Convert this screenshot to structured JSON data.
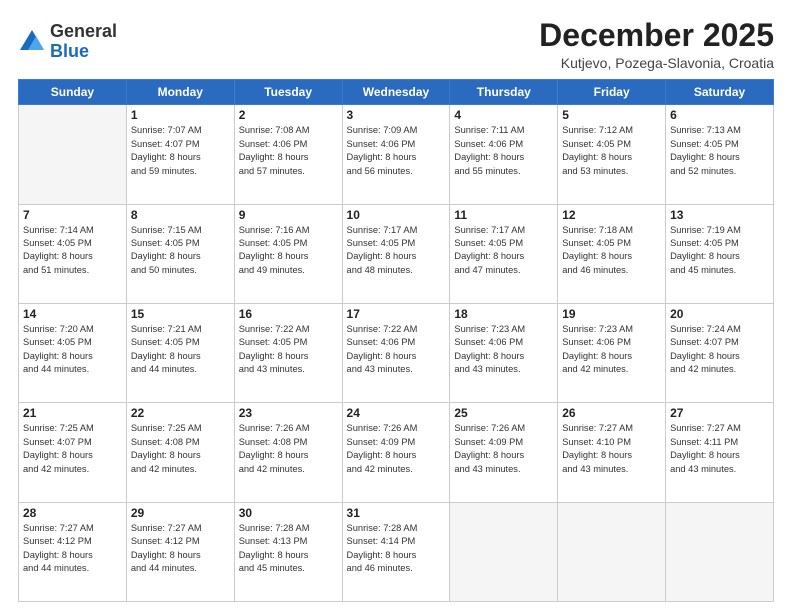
{
  "logo": {
    "general": "General",
    "blue": "Blue"
  },
  "title": "December 2025",
  "location": "Kutjevo, Pozega-Slavonia, Croatia",
  "weekdays": [
    "Sunday",
    "Monday",
    "Tuesday",
    "Wednesday",
    "Thursday",
    "Friday",
    "Saturday"
  ],
  "weeks": [
    [
      {
        "day": "",
        "info": ""
      },
      {
        "day": "1",
        "info": "Sunrise: 7:07 AM\nSunset: 4:07 PM\nDaylight: 8 hours\nand 59 minutes."
      },
      {
        "day": "2",
        "info": "Sunrise: 7:08 AM\nSunset: 4:06 PM\nDaylight: 8 hours\nand 57 minutes."
      },
      {
        "day": "3",
        "info": "Sunrise: 7:09 AM\nSunset: 4:06 PM\nDaylight: 8 hours\nand 56 minutes."
      },
      {
        "day": "4",
        "info": "Sunrise: 7:11 AM\nSunset: 4:06 PM\nDaylight: 8 hours\nand 55 minutes."
      },
      {
        "day": "5",
        "info": "Sunrise: 7:12 AM\nSunset: 4:05 PM\nDaylight: 8 hours\nand 53 minutes."
      },
      {
        "day": "6",
        "info": "Sunrise: 7:13 AM\nSunset: 4:05 PM\nDaylight: 8 hours\nand 52 minutes."
      }
    ],
    [
      {
        "day": "7",
        "info": "Sunrise: 7:14 AM\nSunset: 4:05 PM\nDaylight: 8 hours\nand 51 minutes."
      },
      {
        "day": "8",
        "info": "Sunrise: 7:15 AM\nSunset: 4:05 PM\nDaylight: 8 hours\nand 50 minutes."
      },
      {
        "day": "9",
        "info": "Sunrise: 7:16 AM\nSunset: 4:05 PM\nDaylight: 8 hours\nand 49 minutes."
      },
      {
        "day": "10",
        "info": "Sunrise: 7:17 AM\nSunset: 4:05 PM\nDaylight: 8 hours\nand 48 minutes."
      },
      {
        "day": "11",
        "info": "Sunrise: 7:17 AM\nSunset: 4:05 PM\nDaylight: 8 hours\nand 47 minutes."
      },
      {
        "day": "12",
        "info": "Sunrise: 7:18 AM\nSunset: 4:05 PM\nDaylight: 8 hours\nand 46 minutes."
      },
      {
        "day": "13",
        "info": "Sunrise: 7:19 AM\nSunset: 4:05 PM\nDaylight: 8 hours\nand 45 minutes."
      }
    ],
    [
      {
        "day": "14",
        "info": "Sunrise: 7:20 AM\nSunset: 4:05 PM\nDaylight: 8 hours\nand 44 minutes."
      },
      {
        "day": "15",
        "info": "Sunrise: 7:21 AM\nSunset: 4:05 PM\nDaylight: 8 hours\nand 44 minutes."
      },
      {
        "day": "16",
        "info": "Sunrise: 7:22 AM\nSunset: 4:05 PM\nDaylight: 8 hours\nand 43 minutes."
      },
      {
        "day": "17",
        "info": "Sunrise: 7:22 AM\nSunset: 4:06 PM\nDaylight: 8 hours\nand 43 minutes."
      },
      {
        "day": "18",
        "info": "Sunrise: 7:23 AM\nSunset: 4:06 PM\nDaylight: 8 hours\nand 43 minutes."
      },
      {
        "day": "19",
        "info": "Sunrise: 7:23 AM\nSunset: 4:06 PM\nDaylight: 8 hours\nand 42 minutes."
      },
      {
        "day": "20",
        "info": "Sunrise: 7:24 AM\nSunset: 4:07 PM\nDaylight: 8 hours\nand 42 minutes."
      }
    ],
    [
      {
        "day": "21",
        "info": "Sunrise: 7:25 AM\nSunset: 4:07 PM\nDaylight: 8 hours\nand 42 minutes."
      },
      {
        "day": "22",
        "info": "Sunrise: 7:25 AM\nSunset: 4:08 PM\nDaylight: 8 hours\nand 42 minutes."
      },
      {
        "day": "23",
        "info": "Sunrise: 7:26 AM\nSunset: 4:08 PM\nDaylight: 8 hours\nand 42 minutes."
      },
      {
        "day": "24",
        "info": "Sunrise: 7:26 AM\nSunset: 4:09 PM\nDaylight: 8 hours\nand 42 minutes."
      },
      {
        "day": "25",
        "info": "Sunrise: 7:26 AM\nSunset: 4:09 PM\nDaylight: 8 hours\nand 43 minutes."
      },
      {
        "day": "26",
        "info": "Sunrise: 7:27 AM\nSunset: 4:10 PM\nDaylight: 8 hours\nand 43 minutes."
      },
      {
        "day": "27",
        "info": "Sunrise: 7:27 AM\nSunset: 4:11 PM\nDaylight: 8 hours\nand 43 minutes."
      }
    ],
    [
      {
        "day": "28",
        "info": "Sunrise: 7:27 AM\nSunset: 4:12 PM\nDaylight: 8 hours\nand 44 minutes."
      },
      {
        "day": "29",
        "info": "Sunrise: 7:27 AM\nSunset: 4:12 PM\nDaylight: 8 hours\nand 44 minutes."
      },
      {
        "day": "30",
        "info": "Sunrise: 7:28 AM\nSunset: 4:13 PM\nDaylight: 8 hours\nand 45 minutes."
      },
      {
        "day": "31",
        "info": "Sunrise: 7:28 AM\nSunset: 4:14 PM\nDaylight: 8 hours\nand 46 minutes."
      },
      {
        "day": "",
        "info": ""
      },
      {
        "day": "",
        "info": ""
      },
      {
        "day": "",
        "info": ""
      }
    ]
  ]
}
